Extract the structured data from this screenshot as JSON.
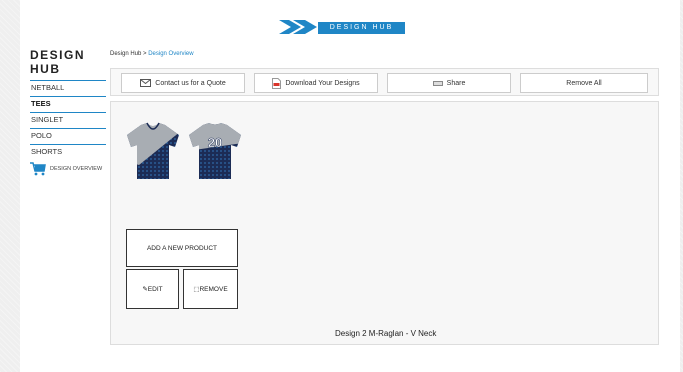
{
  "logo": {
    "text": "DESIGN HUB",
    "color": "#1f86c6"
  },
  "sidebar": {
    "title": "DESIGN HUB",
    "items": [
      {
        "label": "NETBALL"
      },
      {
        "label": "TEES"
      },
      {
        "label": "SINGLET"
      },
      {
        "label": "POLO"
      },
      {
        "label": "SHORTS"
      }
    ],
    "active": "TEES",
    "overview_label": "DESIGN OVERVIEW"
  },
  "breadcrumb": {
    "root": "Design Hub",
    "separator": " > ",
    "current": "Design Overview"
  },
  "toolbar": {
    "contact_label": "Contact us for a Quote",
    "download_label": "Download Your Designs",
    "share_label": "Share",
    "remove_all_label": "Remove All"
  },
  "design": {
    "name": "Design 2 M-Raglan - V Neck",
    "back_number": "20",
    "colors": {
      "primary": "#1c2c55",
      "secondary": "#a8adb3",
      "accent": "#2e6aa8"
    },
    "add_product_label": "ADD A NEW PRODUCT",
    "edit_label": "✎EDIT",
    "remove_label": "⬚REMOVE"
  }
}
